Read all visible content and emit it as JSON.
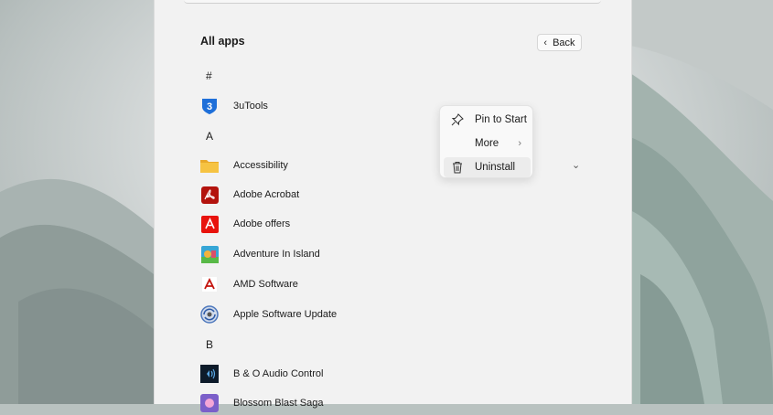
{
  "start_menu": {
    "title": "All apps",
    "back_label": "Back",
    "groups": [
      {
        "letter": "#",
        "apps": [
          {
            "label": "3uTools",
            "icon": "3utools-icon"
          }
        ]
      },
      {
        "letter": "A",
        "apps": [
          {
            "label": "Accessibility",
            "icon": "folder-icon"
          },
          {
            "label": "Adobe Acrobat",
            "icon": "adobe-acrobat-icon"
          },
          {
            "label": "Adobe offers",
            "icon": "adobe-offers-icon"
          },
          {
            "label": "Adventure In Island",
            "icon": "adventure-island-icon"
          },
          {
            "label": "AMD Software",
            "icon": "amd-icon"
          },
          {
            "label": "Apple Software Update",
            "icon": "apple-update-icon"
          }
        ]
      },
      {
        "letter": "B",
        "apps": [
          {
            "label": "B & O Audio Control",
            "icon": "bo-audio-icon"
          },
          {
            "label": "Blossom Blast Saga",
            "icon": "blossom-blast-icon"
          }
        ]
      }
    ]
  },
  "context_menu": {
    "items": [
      {
        "label": "Pin to Start",
        "icon": "pin-icon"
      },
      {
        "label": "More",
        "icon": "",
        "has_submenu": true
      },
      {
        "label": "Uninstall",
        "icon": "trash-icon"
      }
    ]
  },
  "colors": {
    "accent_blue": "#1e6fd9",
    "adobe_red": "#c4120c"
  }
}
